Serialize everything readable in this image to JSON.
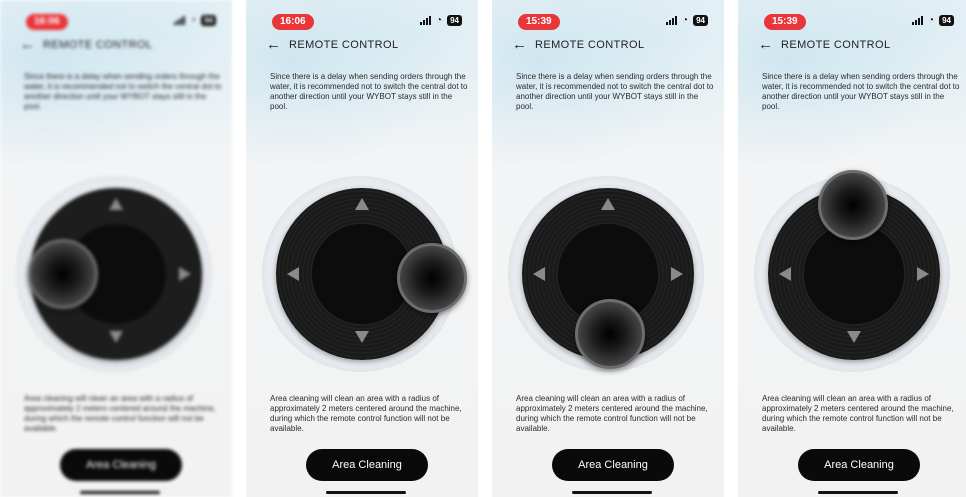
{
  "statusbar": {
    "time": "16:06",
    "time_alt": "15:39",
    "battery": "94"
  },
  "header": {
    "title": "REMOTE CONTROL"
  },
  "description": "Since there is a delay when sending orders through the water,  it is recommended not to switch the central dot to another direction until your WYBOT stays still in the pool.",
  "note": "Area cleaning will clean an area with a radius of approximately 2 meters centered around the machine, during which the remote control function will not be available.",
  "button": {
    "label": "Area Cleaning"
  },
  "icons": {
    "back": "back-arrow-icon",
    "signal": "signal-icon",
    "wifi": "wifi-icon",
    "battery": "battery-icon"
  },
  "colors": {
    "time_pill": "#e8363a",
    "button": "#0a0a0a",
    "pad": "#1a1a1a"
  }
}
